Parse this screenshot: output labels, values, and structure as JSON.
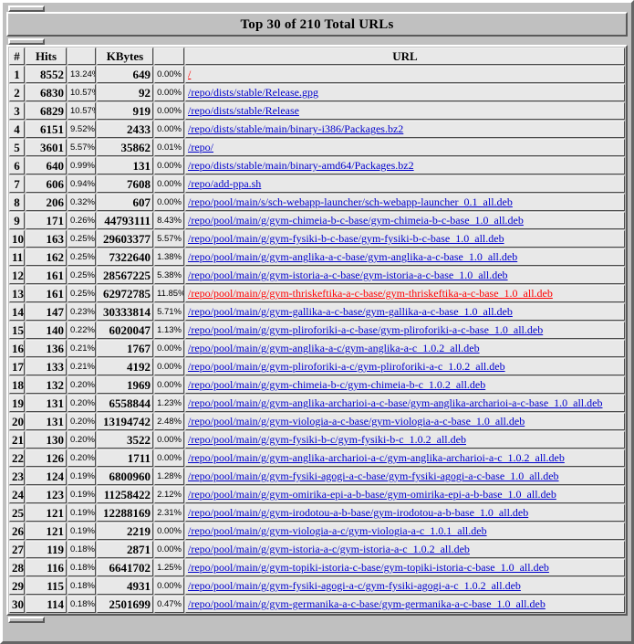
{
  "window": {
    "title": "Top 30 of 210 Total URLs"
  },
  "table": {
    "columns": {
      "num": "#",
      "hits": "Hits",
      "hits_pct": "",
      "kbytes": "KBytes",
      "kbytes_pct": "",
      "url": "URL"
    },
    "colors": {
      "hits_header_bg": "#00805f",
      "kbytes_header_bg": "#ff0000",
      "url_header_bg": "#00ffff",
      "link": "#0000cc",
      "link_highlight": "#ff0000",
      "cell_bg": "#e8e8e8",
      "chrome_bg": "#c0c0c0"
    },
    "rows": [
      {
        "num": "1",
        "hits": "8552",
        "hits_pct": "13.24%",
        "kbytes": "649",
        "kbytes_pct": "0.00%",
        "url": "/",
        "highlight": true
      },
      {
        "num": "2",
        "hits": "6830",
        "hits_pct": "10.57%",
        "kbytes": "92",
        "kbytes_pct": "0.00%",
        "url": "/repo/dists/stable/Release.gpg",
        "highlight": false
      },
      {
        "num": "3",
        "hits": "6829",
        "hits_pct": "10.57%",
        "kbytes": "919",
        "kbytes_pct": "0.00%",
        "url": "/repo/dists/stable/Release",
        "highlight": false
      },
      {
        "num": "4",
        "hits": "6151",
        "hits_pct": "9.52%",
        "kbytes": "2433",
        "kbytes_pct": "0.00%",
        "url": "/repo/dists/stable/main/binary-i386/Packages.bz2",
        "highlight": false
      },
      {
        "num": "5",
        "hits": "3601",
        "hits_pct": "5.57%",
        "kbytes": "35862",
        "kbytes_pct": "0.01%",
        "url": "/repo/",
        "highlight": false
      },
      {
        "num": "6",
        "hits": "640",
        "hits_pct": "0.99%",
        "kbytes": "131",
        "kbytes_pct": "0.00%",
        "url": "/repo/dists/stable/main/binary-amd64/Packages.bz2",
        "highlight": false
      },
      {
        "num": "7",
        "hits": "606",
        "hits_pct": "0.94%",
        "kbytes": "7608",
        "kbytes_pct": "0.00%",
        "url": "/repo/add-ppa.sh",
        "highlight": false
      },
      {
        "num": "8",
        "hits": "206",
        "hits_pct": "0.32%",
        "kbytes": "607",
        "kbytes_pct": "0.00%",
        "url": "/repo/pool/main/s/sch-webapp-launcher/sch-webapp-launcher_0.1_all.deb",
        "highlight": false
      },
      {
        "num": "9",
        "hits": "171",
        "hits_pct": "0.26%",
        "kbytes": "44793111",
        "kbytes_pct": "8.43%",
        "url": "/repo/pool/main/g/gym-chimeia-b-c-base/gym-chimeia-b-c-base_1.0_all.deb",
        "highlight": false
      },
      {
        "num": "10",
        "hits": "163",
        "hits_pct": "0.25%",
        "kbytes": "29603377",
        "kbytes_pct": "5.57%",
        "url": "/repo/pool/main/g/gym-fysiki-b-c-base/gym-fysiki-b-c-base_1.0_all.deb",
        "highlight": false
      },
      {
        "num": "11",
        "hits": "162",
        "hits_pct": "0.25%",
        "kbytes": "7322640",
        "kbytes_pct": "1.38%",
        "url": "/repo/pool/main/g/gym-anglika-a-c-base/gym-anglika-a-c-base_1.0_all.deb",
        "highlight": false
      },
      {
        "num": "12",
        "hits": "161",
        "hits_pct": "0.25%",
        "kbytes": "28567225",
        "kbytes_pct": "5.38%",
        "url": "/repo/pool/main/g/gym-istoria-a-c-base/gym-istoria-a-c-base_1.0_all.deb",
        "highlight": false
      },
      {
        "num": "13",
        "hits": "161",
        "hits_pct": "0.25%",
        "kbytes": "62972785",
        "kbytes_pct": "11.85%",
        "url": "/repo/pool/main/g/gym-thriskeftika-a-c-base/gym-thriskeftika-a-c-base_1.0_all.deb",
        "highlight": true
      },
      {
        "num": "14",
        "hits": "147",
        "hits_pct": "0.23%",
        "kbytes": "30333814",
        "kbytes_pct": "5.71%",
        "url": "/repo/pool/main/g/gym-gallika-a-c-base/gym-gallika-a-c-base_1.0_all.deb",
        "highlight": false
      },
      {
        "num": "15",
        "hits": "140",
        "hits_pct": "0.22%",
        "kbytes": "6020047",
        "kbytes_pct": "1.13%",
        "url": "/repo/pool/main/g/gym-pliroforiki-a-c-base/gym-pliroforiki-a-c-base_1.0_all.deb",
        "highlight": false
      },
      {
        "num": "16",
        "hits": "136",
        "hits_pct": "0.21%",
        "kbytes": "1767",
        "kbytes_pct": "0.00%",
        "url": "/repo/pool/main/g/gym-anglika-a-c/gym-anglika-a-c_1.0.2_all.deb",
        "highlight": false
      },
      {
        "num": "17",
        "hits": "133",
        "hits_pct": "0.21%",
        "kbytes": "4192",
        "kbytes_pct": "0.00%",
        "url": "/repo/pool/main/g/gym-pliroforiki-a-c/gym-pliroforiki-a-c_1.0.2_all.deb",
        "highlight": false
      },
      {
        "num": "18",
        "hits": "132",
        "hits_pct": "0.20%",
        "kbytes": "1969",
        "kbytes_pct": "0.00%",
        "url": "/repo/pool/main/g/gym-chimeia-b-c/gym-chimeia-b-c_1.0.2_all.deb",
        "highlight": false
      },
      {
        "num": "19",
        "hits": "131",
        "hits_pct": "0.20%",
        "kbytes": "6558844",
        "kbytes_pct": "1.23%",
        "url": "/repo/pool/main/g/gym-anglika-archarioi-a-c-base/gym-anglika-archarioi-a-c-base_1.0_all.deb",
        "highlight": false
      },
      {
        "num": "20",
        "hits": "131",
        "hits_pct": "0.20%",
        "kbytes": "13194742",
        "kbytes_pct": "2.48%",
        "url": "/repo/pool/main/g/gym-viologia-a-c-base/gym-viologia-a-c-base_1.0_all.deb",
        "highlight": false
      },
      {
        "num": "21",
        "hits": "130",
        "hits_pct": "0.20%",
        "kbytes": "3522",
        "kbytes_pct": "0.00%",
        "url": "/repo/pool/main/g/gym-fysiki-b-c/gym-fysiki-b-c_1.0.2_all.deb",
        "highlight": false
      },
      {
        "num": "22",
        "hits": "126",
        "hits_pct": "0.20%",
        "kbytes": "1711",
        "kbytes_pct": "0.00%",
        "url": "/repo/pool/main/g/gym-anglika-archarioi-a-c/gym-anglika-archarioi-a-c_1.0.2_all.deb",
        "highlight": false
      },
      {
        "num": "23",
        "hits": "124",
        "hits_pct": "0.19%",
        "kbytes": "6800960",
        "kbytes_pct": "1.28%",
        "url": "/repo/pool/main/g/gym-fysiki-agogi-a-c-base/gym-fysiki-agogi-a-c-base_1.0_all.deb",
        "highlight": false
      },
      {
        "num": "24",
        "hits": "123",
        "hits_pct": "0.19%",
        "kbytes": "11258422",
        "kbytes_pct": "2.12%",
        "url": "/repo/pool/main/g/gym-omirika-epi-a-b-base/gym-omirika-epi-a-b-base_1.0_all.deb",
        "highlight": false
      },
      {
        "num": "25",
        "hits": "121",
        "hits_pct": "0.19%",
        "kbytes": "12288169",
        "kbytes_pct": "2.31%",
        "url": "/repo/pool/main/g/gym-irodotou-a-b-base/gym-irodotou-a-b-base_1.0_all.deb",
        "highlight": false
      },
      {
        "num": "26",
        "hits": "121",
        "hits_pct": "0.19%",
        "kbytes": "2219",
        "kbytes_pct": "0.00%",
        "url": "/repo/pool/main/g/gym-viologia-a-c/gym-viologia-a-c_1.0.1_all.deb",
        "highlight": false
      },
      {
        "num": "27",
        "hits": "119",
        "hits_pct": "0.18%",
        "kbytes": "2871",
        "kbytes_pct": "0.00%",
        "url": "/repo/pool/main/g/gym-istoria-a-c/gym-istoria-a-c_1.0.2_all.deb",
        "highlight": false
      },
      {
        "num": "28",
        "hits": "116",
        "hits_pct": "0.18%",
        "kbytes": "6641702",
        "kbytes_pct": "1.25%",
        "url": "/repo/pool/main/g/gym-topiki-istoria-c-base/gym-topiki-istoria-c-base_1.0_all.deb",
        "highlight": false
      },
      {
        "num": "29",
        "hits": "115",
        "hits_pct": "0.18%",
        "kbytes": "4931",
        "kbytes_pct": "0.00%",
        "url": "/repo/pool/main/g/gym-fysiki-agogi-a-c/gym-fysiki-agogi-a-c_1.0.2_all.deb",
        "highlight": false
      },
      {
        "num": "30",
        "hits": "114",
        "hits_pct": "0.18%",
        "kbytes": "2501699",
        "kbytes_pct": "0.47%",
        "url": "/repo/pool/main/g/gym-germanika-a-c-base/gym-germanika-a-c-base_1.0_all.deb",
        "highlight": false
      }
    ]
  }
}
